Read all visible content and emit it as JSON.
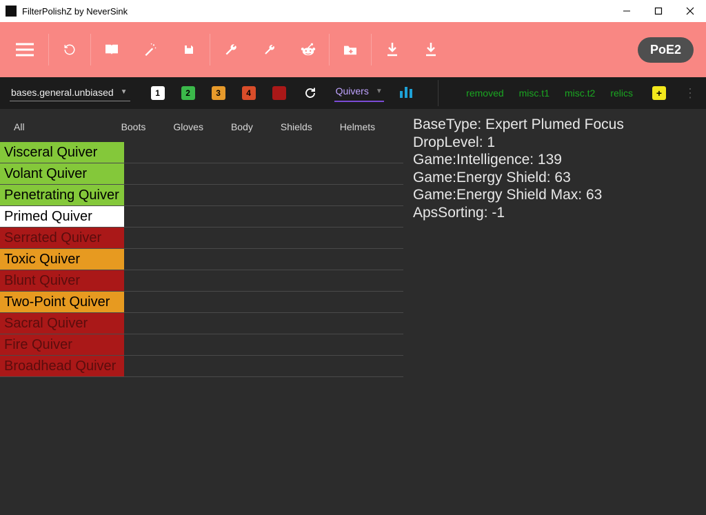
{
  "window": {
    "title": "FilterPolishZ by NeverSink"
  },
  "toolbar": {
    "poe2_label": "PoE2"
  },
  "subbar": {
    "bases_dropdown": "bases.general.unbiased",
    "chip1": "1",
    "chip2": "2",
    "chip3": "3",
    "chip4": "4",
    "quivers_label": "Quivers",
    "link_removed": "removed",
    "link_misct1": "misc.t1",
    "link_misct2": "misc.t2",
    "link_relics": "relics",
    "plus": "+"
  },
  "tabs": {
    "all": "All",
    "boots": "Boots",
    "gloves": "Gloves",
    "body": "Body",
    "shields": "Shields",
    "helmets": "Helmets"
  },
  "items": [
    {
      "label": "Visceral Quiver",
      "tier": "green"
    },
    {
      "label": "Volant Quiver",
      "tier": "green"
    },
    {
      "label": "Penetrating Quiver",
      "tier": "green"
    },
    {
      "label": "Primed Quiver",
      "tier": "white"
    },
    {
      "label": "Serrated Quiver",
      "tier": "red"
    },
    {
      "label": "Toxic Quiver",
      "tier": "orange"
    },
    {
      "label": "Blunt Quiver",
      "tier": "red"
    },
    {
      "label": "Two-Point Quiver",
      "tier": "orange"
    },
    {
      "label": "Sacral Quiver",
      "tier": "red"
    },
    {
      "label": "Fire Quiver",
      "tier": "red"
    },
    {
      "label": "Broadhead Quiver",
      "tier": "red"
    }
  ],
  "details": {
    "l1": "BaseType: Expert Plumed Focus",
    "l2": "DropLevel: 1",
    "l3": "Game:Intelligence: 139",
    "l4": "Game:Energy Shield: 63",
    "l5": "Game:Energy Shield Max: 63",
    "l6": "ApsSorting: -1"
  }
}
